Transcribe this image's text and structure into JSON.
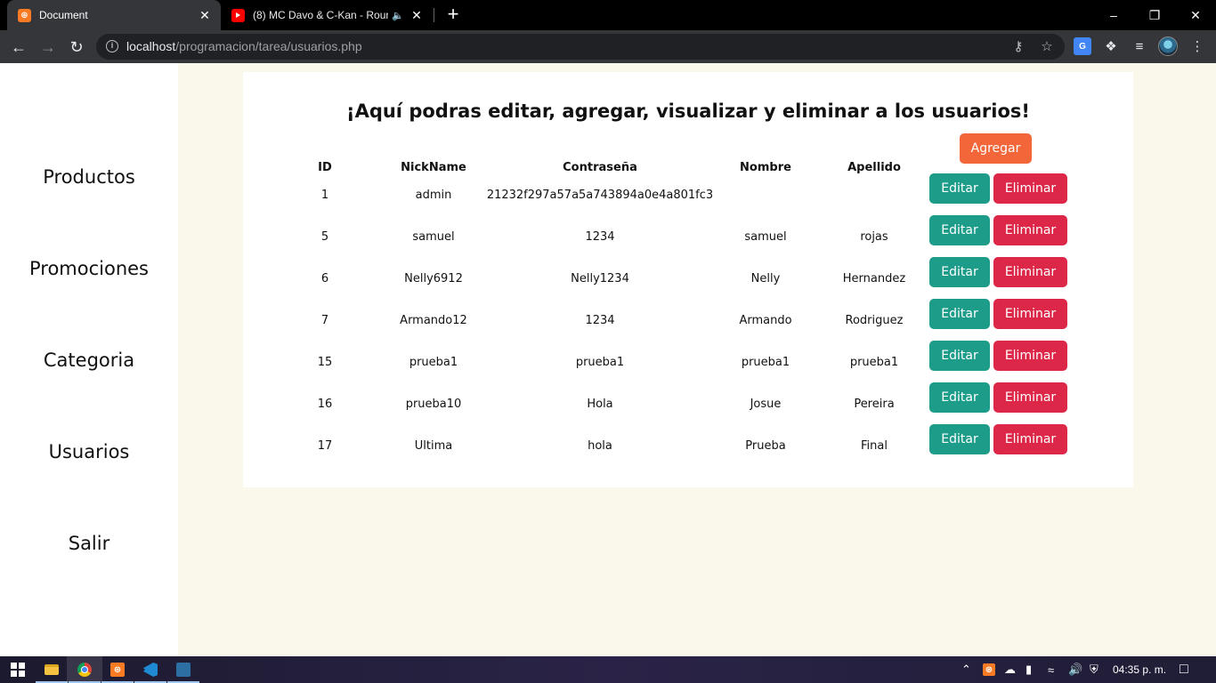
{
  "browser": {
    "tabs": [
      {
        "title": "Document",
        "favicon": "xampp-icon",
        "active": true
      },
      {
        "title": "(8) MC Davo & C-Kan - Roun",
        "favicon": "youtube-icon",
        "audio": true,
        "active": false
      }
    ],
    "url_host": "localhost",
    "url_path": "/programacion/tarea/usuarios.php"
  },
  "sidebar": {
    "items": [
      {
        "label": "Productos"
      },
      {
        "label": "Promociones"
      },
      {
        "label": "Categoria"
      },
      {
        "label": "Usuarios"
      },
      {
        "label": "Salir"
      }
    ]
  },
  "main": {
    "heading": "¡Aquí podras editar, agregar, visualizar y eliminar a los usuarios!",
    "add_label": "Agregar",
    "columns": [
      "ID",
      "NickName",
      "Contraseña",
      "Nombre",
      "Apellido"
    ],
    "edit_label": "Editar",
    "delete_label": "Eliminar",
    "rows": [
      {
        "id": "1",
        "nick": "admin",
        "pass": "21232f297a57a5a743894a0e4a801fc3",
        "nombre": "",
        "apellido": ""
      },
      {
        "id": "5",
        "nick": "samuel",
        "pass": "1234",
        "nombre": "samuel",
        "apellido": "rojas"
      },
      {
        "id": "6",
        "nick": "Nelly6912",
        "pass": "Nelly1234",
        "nombre": "Nelly",
        "apellido": "Hernandez"
      },
      {
        "id": "7",
        "nick": "Armando12",
        "pass": "1234",
        "nombre": "Armando",
        "apellido": "Rodriguez"
      },
      {
        "id": "15",
        "nick": "prueba1",
        "pass": "prueba1",
        "nombre": "prueba1",
        "apellido": "prueba1"
      },
      {
        "id": "16",
        "nick": "prueba10",
        "pass": "Hola",
        "nombre": "Josue",
        "apellido": "Pereira"
      },
      {
        "id": "17",
        "nick": "Ultima",
        "pass": "hola",
        "nombre": "Prueba",
        "apellido": "Final"
      }
    ]
  },
  "colors": {
    "add": "#f2663a",
    "edit": "#1e9c8a",
    "delete": "#dc2748",
    "page_bg": "#faf8ea"
  },
  "taskbar": {
    "clock": "04:35 p. m."
  }
}
